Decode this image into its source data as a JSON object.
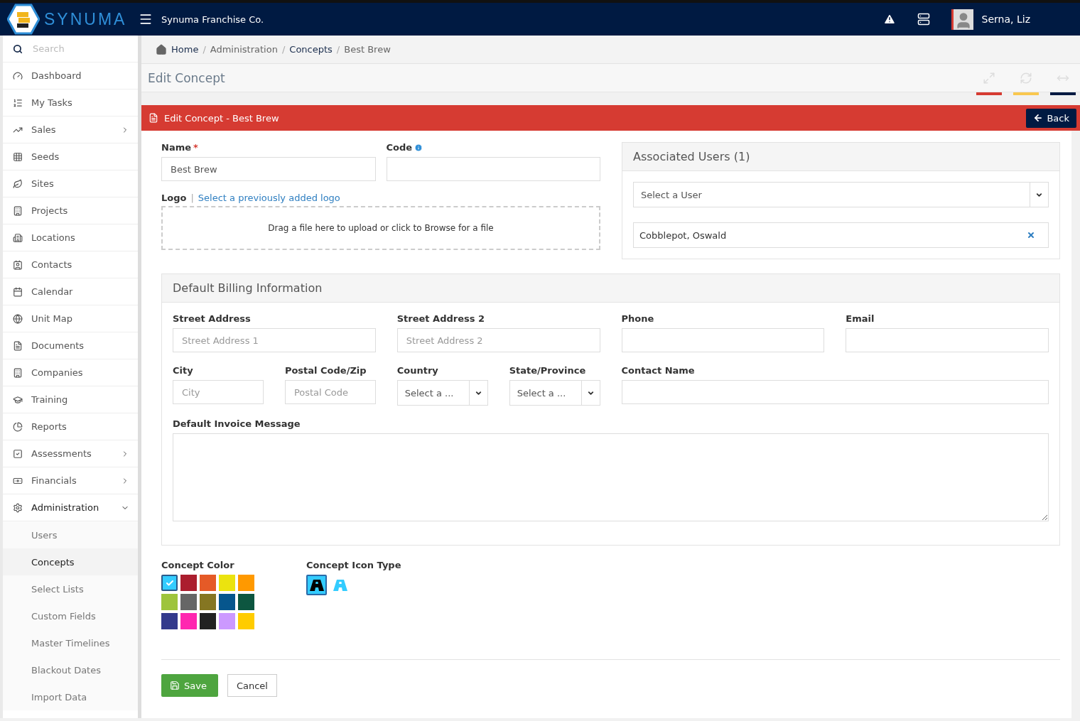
{
  "header": {
    "brand": "SYNUMA",
    "company": "Synuma Franchise Co.",
    "user": "Serna, Liz"
  },
  "sidebar": {
    "search": {
      "placeholder": "Search"
    },
    "items": [
      {
        "label": "Dashboard",
        "kind": "link"
      },
      {
        "label": "My Tasks",
        "kind": "link"
      },
      {
        "label": "Sales",
        "kind": "group",
        "expanded": false
      },
      {
        "label": "Seeds",
        "kind": "link"
      },
      {
        "label": "Sites",
        "kind": "link"
      },
      {
        "label": "Projects",
        "kind": "link"
      },
      {
        "label": "Locations",
        "kind": "link"
      },
      {
        "label": "Contacts",
        "kind": "link"
      },
      {
        "label": "Calendar",
        "kind": "link"
      },
      {
        "label": "Unit Map",
        "kind": "link"
      },
      {
        "label": "Documents",
        "kind": "link"
      },
      {
        "label": "Companies",
        "kind": "link"
      },
      {
        "label": "Training",
        "kind": "link"
      },
      {
        "label": "Reports",
        "kind": "link"
      },
      {
        "label": "Assessments",
        "kind": "group",
        "expanded": false
      },
      {
        "label": "Financials",
        "kind": "group",
        "expanded": false
      },
      {
        "label": "Administration",
        "kind": "group",
        "expanded": true,
        "children": [
          {
            "label": "Users",
            "selected": false
          },
          {
            "label": "Concepts",
            "selected": true
          },
          {
            "label": "Select Lists",
            "selected": false
          },
          {
            "label": "Custom Fields",
            "selected": false
          },
          {
            "label": "Master Timelines",
            "selected": false
          },
          {
            "label": "Blackout Dates",
            "selected": false
          },
          {
            "label": "Import Data",
            "selected": false
          }
        ]
      }
    ]
  },
  "breadcrumb": [
    {
      "label": "Home",
      "kind": "home"
    },
    {
      "separator": "/",
      "label": "Administration",
      "kind": "plain"
    },
    {
      "separator": "/",
      "label": "Concepts",
      "kind": "link"
    },
    {
      "separator": "/",
      "label": "Best Brew",
      "kind": "plain"
    }
  ],
  "page_title": "Edit Concept",
  "panel": {
    "title": "Edit Concept - Best Brew",
    "back": "Back"
  },
  "form": {
    "name": {
      "label": "Name",
      "required_mark": "*",
      "value": "Best Brew"
    },
    "code": {
      "label": "Code"
    },
    "logo": {
      "label": "Logo",
      "separator": "|",
      "link": "Select a previously added logo",
      "dropzone": "Drag a file here to upload or click to Browse for a file"
    }
  },
  "associated_users": {
    "title": "Associated Users (1)",
    "select": {
      "placeholder": "Select a User"
    },
    "users": [
      "Cobblepot, Oswald"
    ]
  },
  "billing": {
    "title": "Default Billing Information",
    "street_address": {
      "label": "Street Address",
      "placeholder": "Street Address 1"
    },
    "street_address_2": {
      "label": "Street Address 2",
      "placeholder": "Street Address 2"
    },
    "phone": {
      "label": "Phone"
    },
    "email": {
      "label": "Email"
    },
    "city": {
      "label": "City",
      "placeholder": "City"
    },
    "postal_code": {
      "label": "Postal Code/Zip",
      "placeholder": "Postal Code"
    },
    "country": {
      "label": "Country",
      "placeholder": "Select a ..."
    },
    "state": {
      "label": "State/Province",
      "placeholder": "Select a ..."
    },
    "contact_name": {
      "label": "Contact Name"
    },
    "invoice_message": {
      "label": "Default Invoice Message"
    }
  },
  "concept_color": {
    "label": "Concept Color",
    "swatches": [
      {
        "color": "#33ccff",
        "selected": true
      },
      {
        "color": "#ab1e2e",
        "selected": false
      },
      {
        "color": "#e55a27",
        "selected": false
      },
      {
        "color": "#ebe30f",
        "selected": false
      },
      {
        "color": "#ff9900",
        "selected": false
      },
      {
        "color": "#9ec43c",
        "selected": false
      },
      {
        "color": "#666666",
        "selected": false
      },
      {
        "color": "#857622",
        "selected": false
      },
      {
        "color": "#06568d",
        "selected": false
      },
      {
        "color": "#0d5640",
        "selected": false
      },
      {
        "color": "#333a8c",
        "selected": false
      },
      {
        "color": "#ff27b0",
        "selected": false
      },
      {
        "color": "#222222",
        "selected": false
      },
      {
        "color": "#cc99ff",
        "selected": false
      },
      {
        "color": "#ffcc00",
        "selected": false
      }
    ]
  },
  "concept_icon_type": {
    "label": "Concept Icon Type",
    "options": [
      {
        "selected": true
      },
      {
        "selected": false
      }
    ]
  },
  "actions": {
    "save": "Save",
    "cancel": "Cancel"
  }
}
